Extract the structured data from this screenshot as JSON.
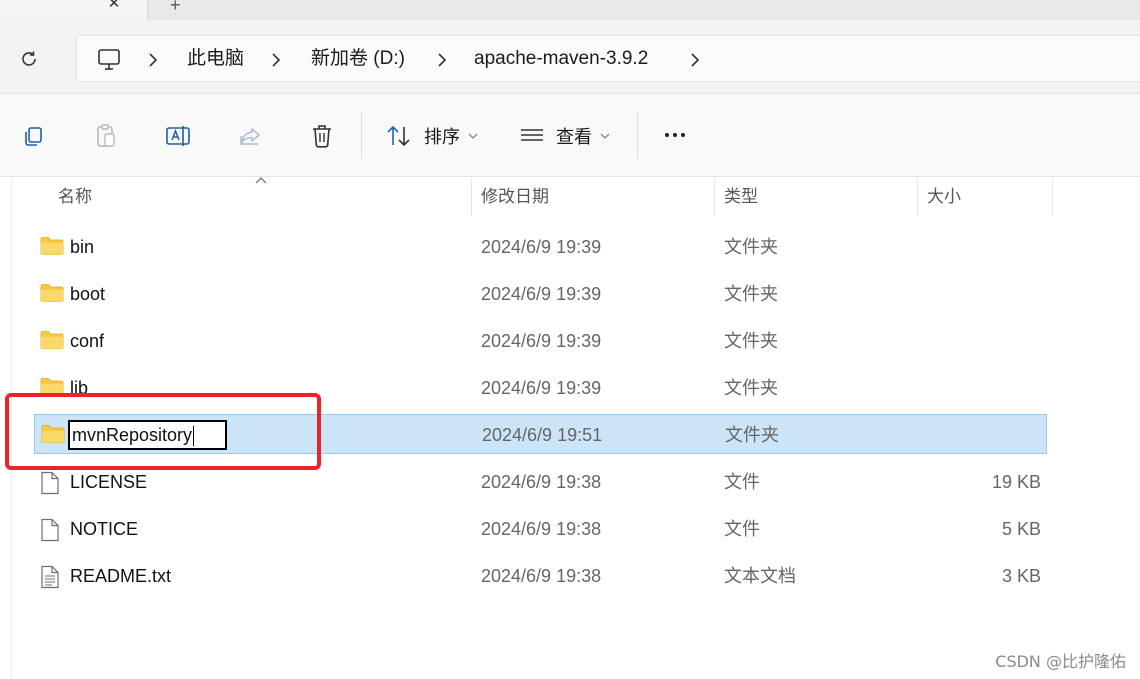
{
  "tab_bar": {
    "close_glyph": "✕",
    "add_glyph": "+"
  },
  "breadcrumb": {
    "items": [
      "此电脑",
      "新加卷 (D:)",
      "apache-maven-3.9.2"
    ],
    "chevron": "›"
  },
  "toolbar": {
    "sort_label": "排序",
    "view_label": "查看",
    "icons": [
      "copy-icon",
      "paste-icon",
      "rename-icon",
      "share-icon",
      "delete-icon",
      "sort-icon",
      "view-icon",
      "more-icon"
    ]
  },
  "columns": {
    "name": "名称",
    "modified": "修改日期",
    "type": "类型",
    "size": "大小"
  },
  "files": [
    {
      "name": "bin",
      "modified": "2024/6/9 19:39",
      "type": "文件夹",
      "size": "",
      "kind": "folder"
    },
    {
      "name": "boot",
      "modified": "2024/6/9 19:39",
      "type": "文件夹",
      "size": "",
      "kind": "folder"
    },
    {
      "name": "conf",
      "modified": "2024/6/9 19:39",
      "type": "文件夹",
      "size": "",
      "kind": "folder"
    },
    {
      "name": "lib",
      "modified": "2024/6/9 19:39",
      "type": "文件夹",
      "size": "",
      "kind": "folder"
    },
    {
      "name": "mvnRepository",
      "modified": "2024/6/9 19:51",
      "type": "文件夹",
      "size": "",
      "kind": "folder",
      "selected": true,
      "renaming": true
    },
    {
      "name": "LICENSE",
      "modified": "2024/6/9 19:38",
      "type": "文件",
      "size": "19 KB",
      "kind": "file"
    },
    {
      "name": "NOTICE",
      "modified": "2024/6/9 19:38",
      "type": "文件",
      "size": "5 KB",
      "kind": "file"
    },
    {
      "name": "README.txt",
      "modified": "2024/6/9 19:38",
      "type": "文本文档",
      "size": "3 KB",
      "kind": "text"
    }
  ],
  "colors": {
    "selection_bg": "#cce4f7",
    "selection_border": "#99c9ef",
    "highlight": "#e8262a",
    "folder": "#f7c948"
  },
  "watermark": "CSDN @比护隆佑"
}
